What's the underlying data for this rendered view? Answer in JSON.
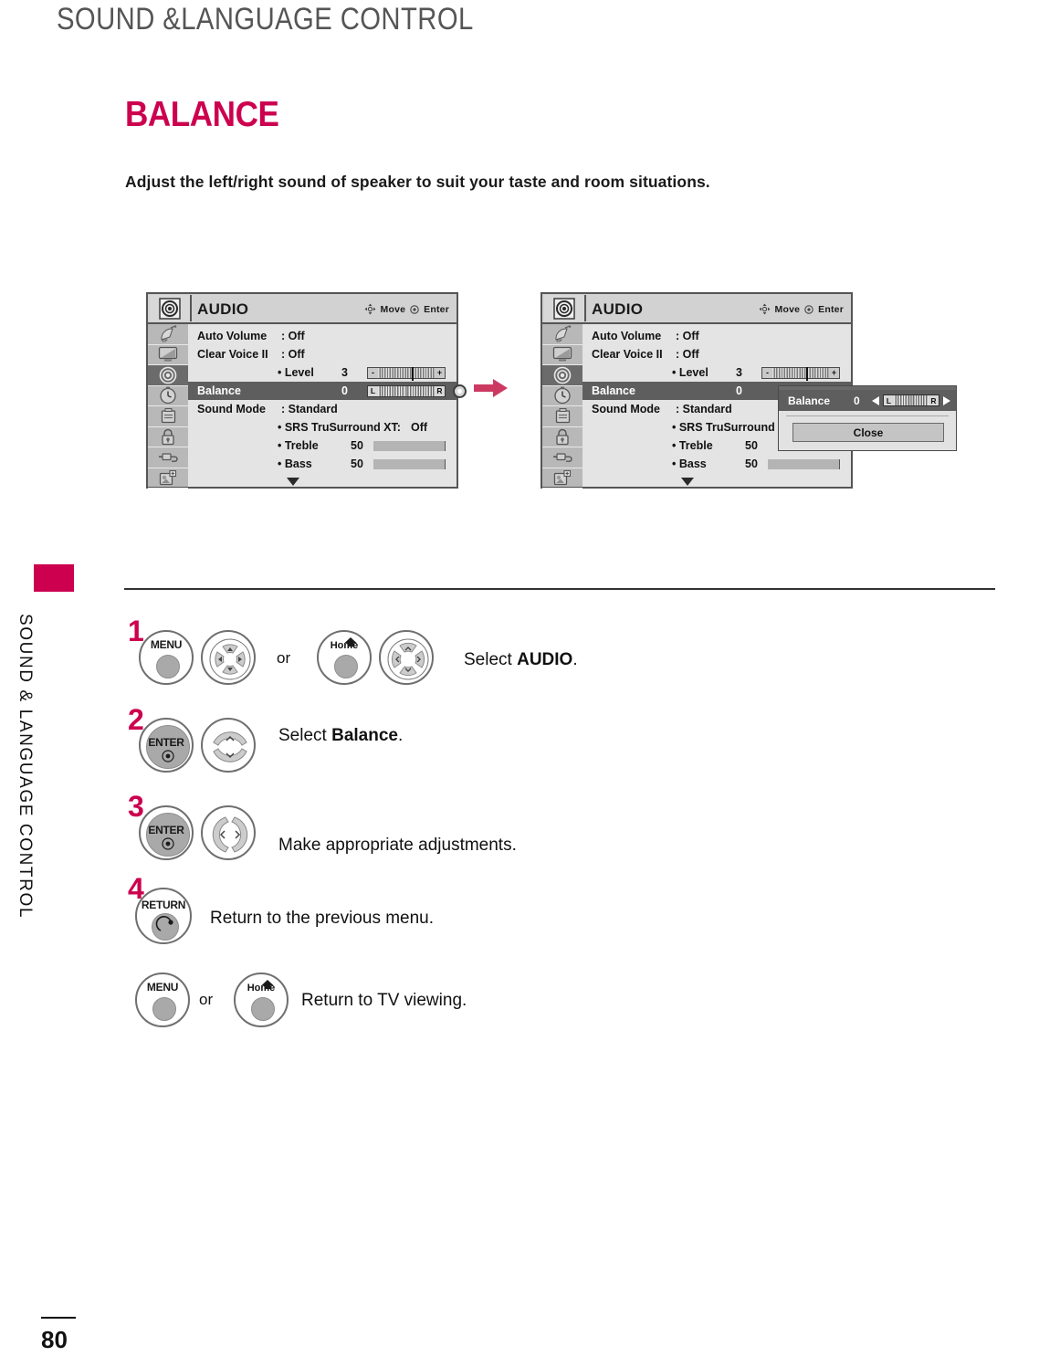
{
  "page": {
    "header": "SOUND &LANGUAGE CONTROL",
    "section_title": "BALANCE",
    "description": "Adjust the left/right sound of speaker to suit your taste and room situations.",
    "sidebar_text": "SOUND & LANGUAGE CONTROL",
    "page_number": "80",
    "accent_color": "#cc004f"
  },
  "osd": {
    "title": "AUDIO",
    "hints": {
      "move": "Move",
      "enter": "Enter"
    },
    "icons": [
      "satellite-dish-icon",
      "tv-picture-icon",
      "audio-speaker-icon",
      "clock-time-icon",
      "setup-options-icon",
      "lock-icon",
      "input-connector-icon",
      "usb-media-icon"
    ],
    "active_icon_index": 2,
    "rows": [
      {
        "label": "Auto Volume",
        "value": ": Off"
      },
      {
        "label": "Clear Voice II",
        "value": ": Off"
      },
      {
        "label": "• Level",
        "value": "3",
        "slider": "level",
        "minus": "-",
        "plus": "+"
      },
      {
        "label": "Balance",
        "value": "0",
        "slider": "balance",
        "left": "L",
        "right": "R",
        "highlight": true
      },
      {
        "label": "Sound Mode",
        "value": ": Standard"
      },
      {
        "label": "• SRS TruSurround XT:",
        "value": "Off"
      },
      {
        "label": "• Treble",
        "value": "50",
        "bar": 50
      },
      {
        "label": "• Bass",
        "value": "50",
        "bar": 50
      }
    ]
  },
  "popup": {
    "title": "Balance",
    "value": "0",
    "slider_left": "L",
    "slider_right": "R",
    "close_label": "Close"
  },
  "steps": [
    {
      "num": "1",
      "button_a": "MENU",
      "or": "or",
      "button_b": "Home",
      "text_prefix": "Select ",
      "text_bold": "AUDIO",
      "text_suffix": "."
    },
    {
      "num": "2",
      "button_a": "ENTER",
      "text_prefix": "Select ",
      "text_bold": "Balance",
      "text_suffix": "."
    },
    {
      "num": "3",
      "button_a": "ENTER",
      "text_prefix": "Make appropriate adjustments.",
      "text_bold": "",
      "text_suffix": ""
    },
    {
      "num": "4",
      "button_a": "RETURN",
      "text_prefix": "Return to the previous menu.",
      "text_bold": "",
      "text_suffix": ""
    },
    {
      "num": "",
      "button_a": "MENU",
      "or": "or",
      "button_b": "Home",
      "text_prefix": "Return to TV viewing.",
      "text_bold": "",
      "text_suffix": ""
    }
  ]
}
